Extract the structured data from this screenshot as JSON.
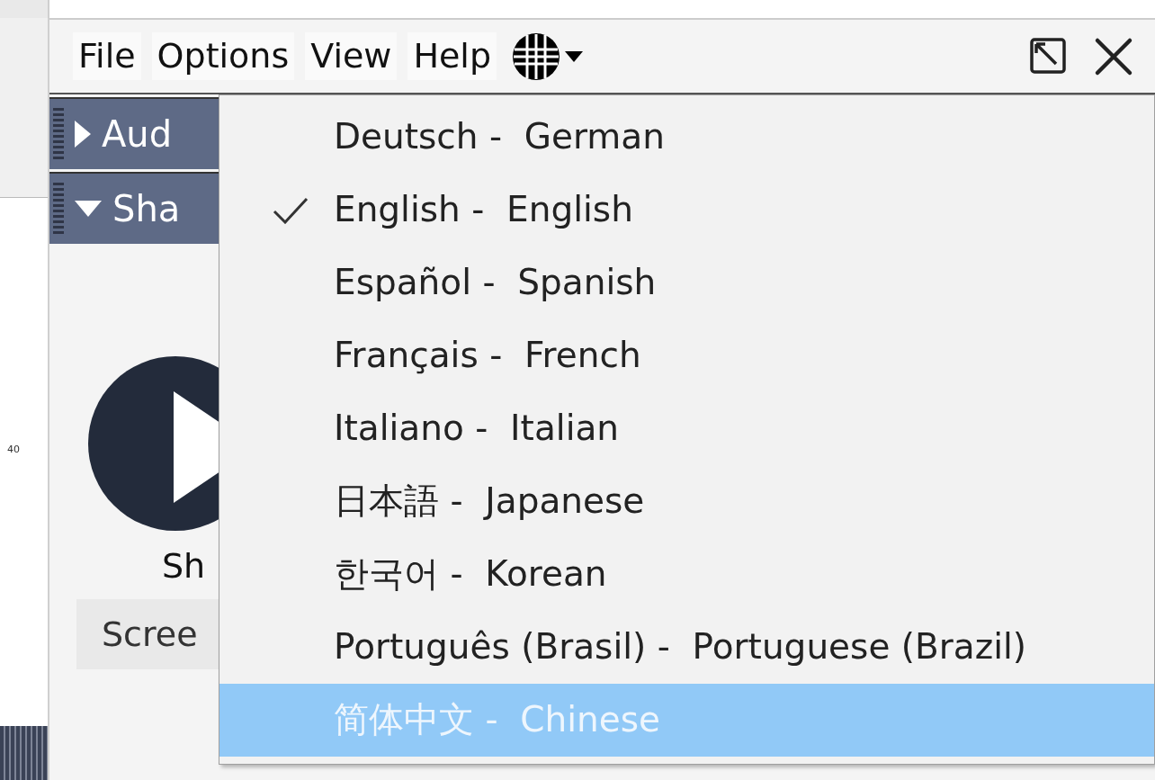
{
  "background": {
    "tick_label": "40"
  },
  "menu_bar": {
    "items": [
      {
        "label": "File"
      },
      {
        "label": "Options"
      },
      {
        "label": "View"
      },
      {
        "label": "Help"
      }
    ]
  },
  "panels": [
    {
      "title": "Aud",
      "expanded": false
    },
    {
      "title": "Sha",
      "expanded": true
    }
  ],
  "shared_panel": {
    "label": "Sh",
    "button": "Scree"
  },
  "language_menu": {
    "items": [
      {
        "label": "Deutsch -  German",
        "checked": false,
        "selected": false
      },
      {
        "label": "English -  English",
        "checked": true,
        "selected": false
      },
      {
        "label": "Español -  Spanish",
        "checked": false,
        "selected": false
      },
      {
        "label": "Français -  French",
        "checked": false,
        "selected": false
      },
      {
        "label": "Italiano -  Italian",
        "checked": false,
        "selected": false
      },
      {
        "label": "日本語 -  Japanese",
        "checked": false,
        "selected": false
      },
      {
        "label": "한국어 -  Korean",
        "checked": false,
        "selected": false
      },
      {
        "label": "Português (Brasil) -  Portuguese (Brazil)",
        "checked": false,
        "selected": false
      },
      {
        "label": "简体中文 -  Chinese",
        "checked": false,
        "selected": true
      }
    ]
  }
}
